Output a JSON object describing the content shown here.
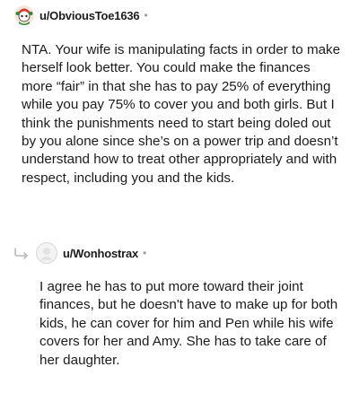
{
  "comments": [
    {
      "username": "u/ObviousToe1636",
      "separator": "•",
      "avatar_icon": "snoo-avatar-icon",
      "text": "NTA. Your wife is manipulating facts in order to make herself look better. You could make the finances more “fair” in that she has to pay 25% of everything while you pay 75% to cover you and both girls. But I think the punishments need to start being doled out by you alone since she’s on a power trip and doesn’t understand how to treat other appropriately and with respect, including you and the kids."
    },
    {
      "username": "u/Wonhostrax",
      "separator": "•",
      "avatar_icon": "default-avatar-icon",
      "reply_icon": "reply-arrow-icon",
      "text": "I agree he has to put more toward their joint finances, but he doesn't have to make up for both kids, he can cover for him and Pen while his wife covers for her and Amy. She has to take care of her daughter."
    }
  ],
  "colors": {
    "text": "#1c1c1c",
    "meta": "#9a9a9a",
    "avatar_red": "#d93a2b",
    "avatar_green": "#2e8b3a"
  }
}
